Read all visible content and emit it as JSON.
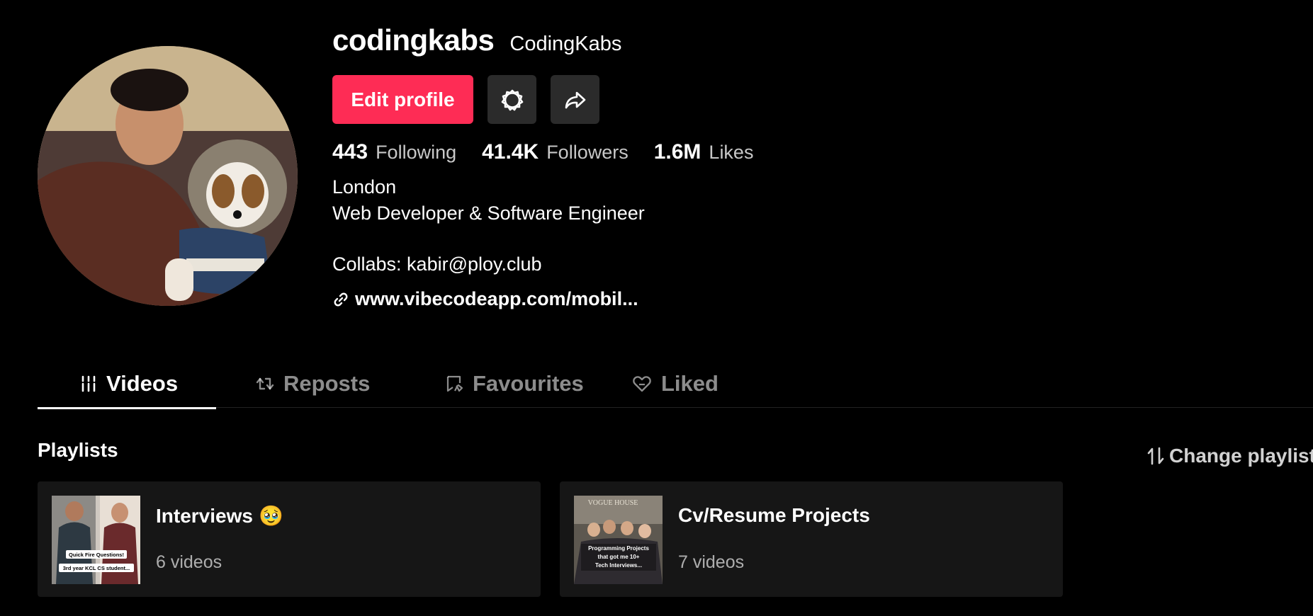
{
  "profile": {
    "username": "codingkabs",
    "nickname": "CodingKabs",
    "edit_label": "Edit profile",
    "stats": {
      "following_count": "443",
      "following_label": "Following",
      "followers_count": "41.4K",
      "followers_label": "Followers",
      "likes_count": "1.6M",
      "likes_label": "Likes"
    },
    "bio": {
      "line1": "London",
      "line2": "Web Developer & Software Engineer",
      "line3": "Collabs: kabir@ploy.club"
    },
    "link": "www.vibecodeapp.com/mobil..."
  },
  "tabs": {
    "videos": "Videos",
    "reposts": "Reposts",
    "favourites": "Favourites",
    "liked": "Liked"
  },
  "playlists": {
    "title": "Playlists",
    "change_label": "Change playlist",
    "items": [
      {
        "title": "Interviews",
        "count": "6 videos",
        "emoji": "🥹",
        "thumb_text1": "Quick Fire Questions!",
        "thumb_text2": "3rd year KCL CS student..."
      },
      {
        "title": "Cv/Resume Projects",
        "count": "7 videos",
        "thumb_sign": "VOGUE HOUSE",
        "thumb_text1": "Programming Projects",
        "thumb_text2": "that got me 10+",
        "thumb_text3": "Tech Interviews..."
      }
    ]
  },
  "colors": {
    "accent": "#fe2c55",
    "background": "#000000",
    "card": "#161616"
  },
  "icons": {
    "settings": "gear-icon",
    "share": "share-arrow-icon",
    "link": "link-icon",
    "videos_tab": "grid-icon",
    "reposts_tab": "repost-icon",
    "favourites_tab": "bookmark-icon",
    "liked_tab": "heart-icon",
    "change_playlist": "sort-arrows-icon"
  }
}
